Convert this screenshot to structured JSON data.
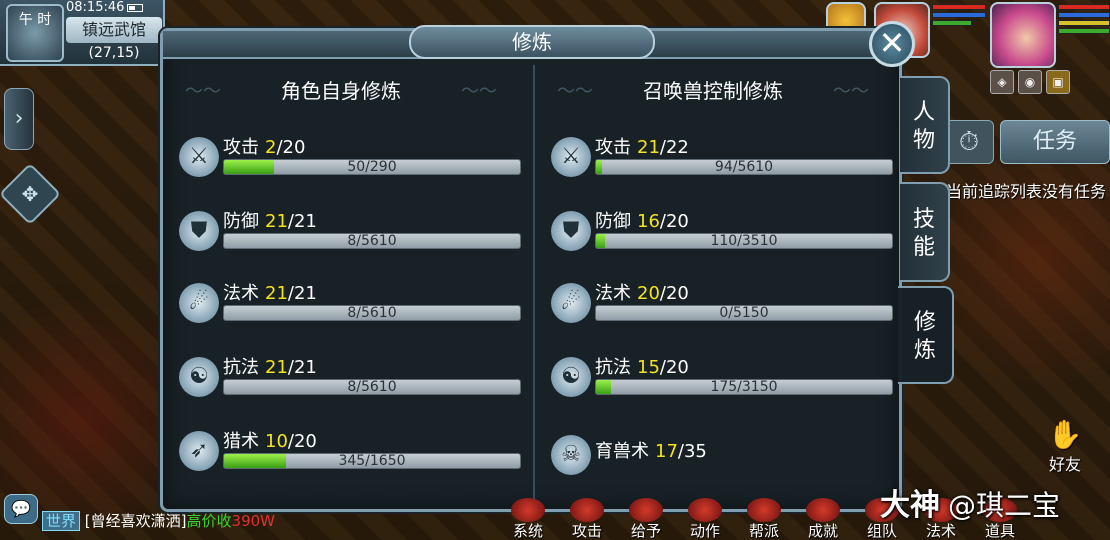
{
  "hud": {
    "period": "午 时",
    "clock": "08:15:46",
    "location": "镇远武馆",
    "coords": "(27,15)"
  },
  "panel": {
    "title": "修炼",
    "close": "✕",
    "left_header": "角色自身修炼",
    "right_header": "召唤兽控制修炼"
  },
  "self_skills": [
    {
      "name": "攻击",
      "level": "2",
      "max": "/20",
      "progress": "50/290",
      "fill": 0.17,
      "icon": "sword-icon",
      "glyph": "⚔"
    },
    {
      "name": "防御",
      "level": "21",
      "max": "/21",
      "progress": "8/5610",
      "fill": 0.0,
      "icon": "shield-icon",
      "glyph": "⛊"
    },
    {
      "name": "法术",
      "level": "21",
      "max": "/21",
      "progress": "8/5610",
      "fill": 0.0,
      "icon": "staff-icon",
      "glyph": "☄"
    },
    {
      "name": "抗法",
      "level": "21",
      "max": "/21",
      "progress": "8/5610",
      "fill": 0.0,
      "icon": "yin-yang-icon",
      "glyph": "☯"
    },
    {
      "name": "猎术",
      "level": "10",
      "max": "/20",
      "progress": "345/1650",
      "fill": 0.21,
      "icon": "bow-icon",
      "glyph": "➶"
    }
  ],
  "pet_skills": [
    {
      "name": "攻击",
      "level": "21",
      "max": "/22",
      "progress": "94/5610",
      "fill": 0.02,
      "icon": "sword-icon",
      "glyph": "⚔"
    },
    {
      "name": "防御",
      "level": "16",
      "max": "/20",
      "progress": "110/3510",
      "fill": 0.03,
      "icon": "shield-icon",
      "glyph": "⛊"
    },
    {
      "name": "法术",
      "level": "20",
      "max": "/20",
      "progress": "0/5150",
      "fill": 0.0,
      "icon": "staff-icon",
      "glyph": "☄"
    },
    {
      "name": "抗法",
      "level": "15",
      "max": "/20",
      "progress": "175/3150",
      "fill": 0.05,
      "icon": "yin-yang-icon",
      "glyph": "☯"
    }
  ],
  "pet_breeding": {
    "name": "育兽术",
    "level": "17",
    "max": "/35",
    "icon": "skull-icon",
    "glyph": "☠"
  },
  "tabs": [
    {
      "label": [
        "人",
        "物"
      ],
      "active": false
    },
    {
      "label": [
        "技",
        "能"
      ],
      "active": false
    },
    {
      "label": [
        "修",
        "炼"
      ],
      "active": true
    }
  ],
  "right_hud": {
    "timer_glyph": "⏱",
    "task": "任务",
    "task_hint": "当前追踪列表没有任务",
    "friends": "好友",
    "friends_glyph": "✋"
  },
  "chat": {
    "icon": "💬",
    "channel": "世界",
    "item": "[曾经喜欢潇洒]",
    "price": "高价收",
    "num": "390W"
  },
  "bottom_menu": [
    "系统",
    "攻击",
    "给予",
    "动作",
    "帮派",
    "成就",
    "组队",
    "法术",
    "道具"
  ],
  "watermark": {
    "brand": "大神",
    "user": "@琪二宝"
  }
}
